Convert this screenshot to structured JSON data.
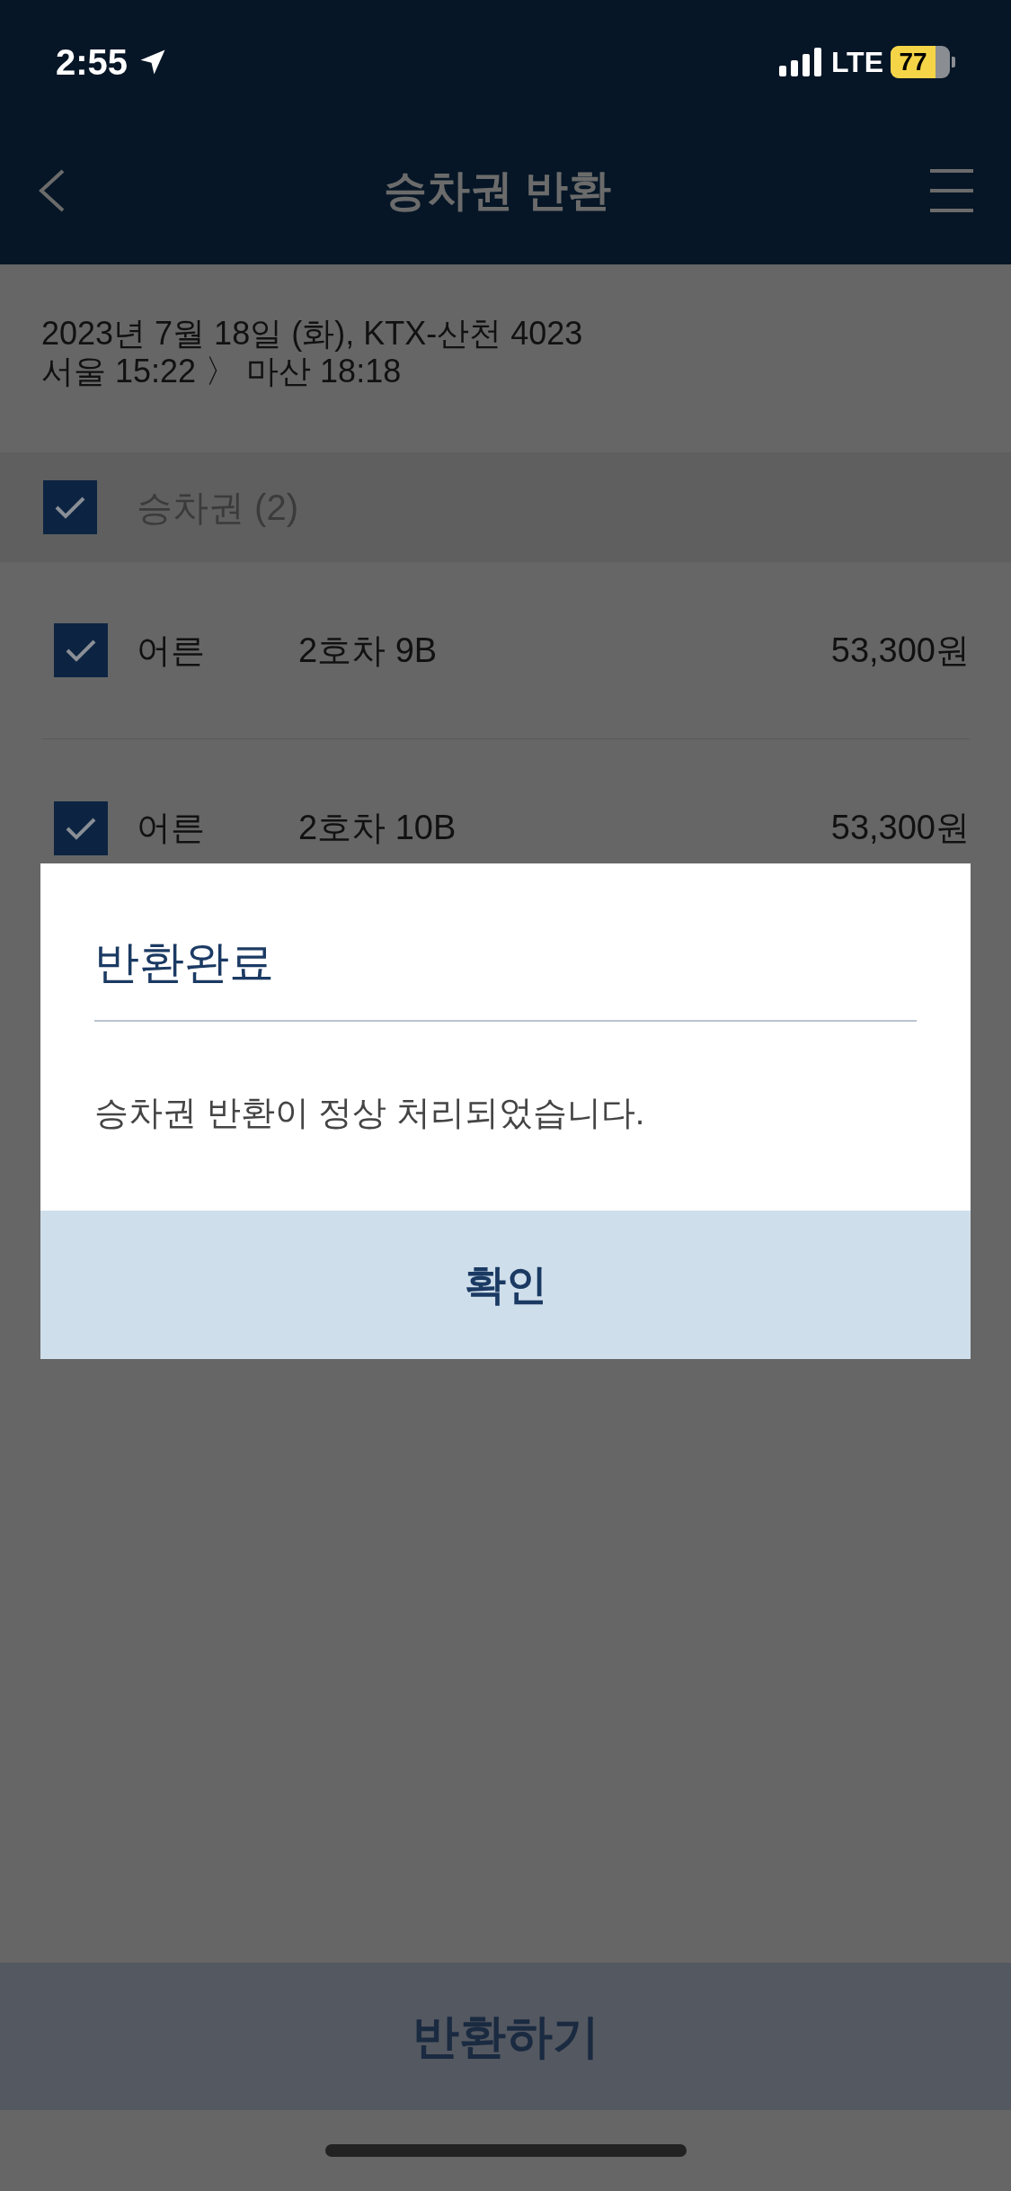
{
  "status_bar": {
    "time": "2:55",
    "network": "LTE",
    "battery": "77"
  },
  "header": {
    "title": "승차권 반환"
  },
  "trip": {
    "line_1": "2023년 7월 18일 (화), KTX-산천 4023",
    "line_2": "서울 15:22 〉 마산 18:18"
  },
  "ticket_group": {
    "label": "승차권 (2)",
    "checked": true
  },
  "tickets": [
    {
      "checked": true,
      "passenger": "어른",
      "seat": "2호차 9B",
      "price": "53,300원"
    },
    {
      "checked": true,
      "passenger": "어른",
      "seat": "2호차 10B",
      "price": "53,300원"
    }
  ],
  "dialog": {
    "title": "반환완료",
    "message": "승차권 반환이 정상 처리되었습니다.",
    "button": "확인"
  },
  "action_button": "반환하기"
}
